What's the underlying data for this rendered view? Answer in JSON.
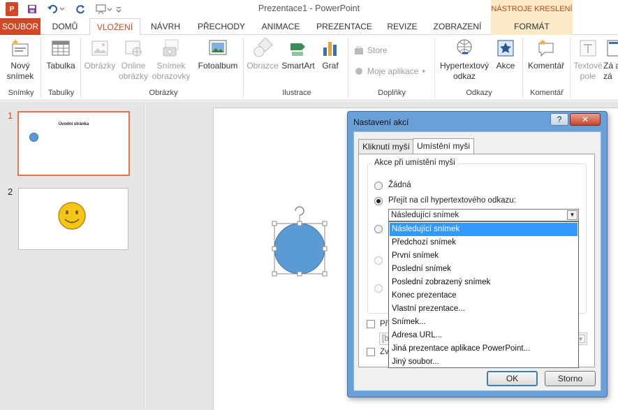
{
  "window": {
    "title": "Prezentace1 - PowerPoint",
    "context_tools": "NÁSTROJE KRESLENÍ"
  },
  "quick_access": {
    "app_icon": "powerpoint-icon",
    "save_icon": "save-icon",
    "undo_icon": "undo-icon",
    "redo_icon": "repeat-icon",
    "start_icon": "present-icon",
    "customize_icon": "chevron-down-icon"
  },
  "tabs": {
    "file": "SOUBOR",
    "home": "DOMŮ",
    "insert": "VLOŽENÍ",
    "design": "NÁVRH",
    "transitions": "PŘECHODY",
    "animations": "ANIMACE",
    "slideshow": "PREZENTACE",
    "review": "REVIZE",
    "view": "ZOBRAZENÍ",
    "format": "FORMÁT"
  },
  "ribbon": {
    "new_slide": "Nový snímek",
    "table": "Tabulka",
    "images": "Obrázky",
    "online_images": "Online obrázky",
    "screenshot": "Snímek obrazovky",
    "photo_album": "Fotoalbum",
    "shapes": "Obrazce",
    "smartart": "SmartArt",
    "chart": "Graf",
    "store": "Store",
    "my_apps": "Moje aplikace",
    "hyperlink": "Hypertextový odkaz",
    "action": "Akce",
    "comment": "Komentář",
    "textbox": "Textové pole",
    "header_footer": "Zá a zá",
    "groups": {
      "slides": "Snímky",
      "tables": "Tabulky",
      "images": "Obrázky",
      "illustrations": "Ilustrace",
      "addins": "Doplňky",
      "links": "Odkazy",
      "comments": "Komentář"
    }
  },
  "thumbnails": [
    {
      "number": "1",
      "title": "Úvodní stránka"
    },
    {
      "number": "2"
    }
  ],
  "dialog": {
    "title": "Nastavení akcí",
    "help": "?",
    "close": "✕",
    "tab_click": "Kliknutí myší",
    "tab_hover": "Umístění myši",
    "group_label": "Akce při umístění myši",
    "option_none": "Žádná",
    "option_hyperlink": "Přejít na cíl hypertextového odkazu:",
    "combo_value": "Následující snímek",
    "play_sound_partial": "Př",
    "sound_partial": "[b",
    "highlight_partial": "Zv",
    "ok": "OK",
    "cancel": "Storno"
  },
  "dropdown_items": [
    "Následující snímek",
    "Předchozí snímek",
    "První snímek",
    "Poslední snímek",
    "Poslední zobrazený snímek",
    "Konec prezentace",
    "Vlastní prezentace...",
    "Snímek...",
    "Adresa URL...",
    "Jiná prezentace aplikace PowerPoint...",
    "Jiný soubor..."
  ],
  "colors": {
    "accent": "#d24726",
    "shape_fill": "#5b9bd5",
    "smiley_fill": "#f5c518",
    "selection": "#3399ff"
  }
}
